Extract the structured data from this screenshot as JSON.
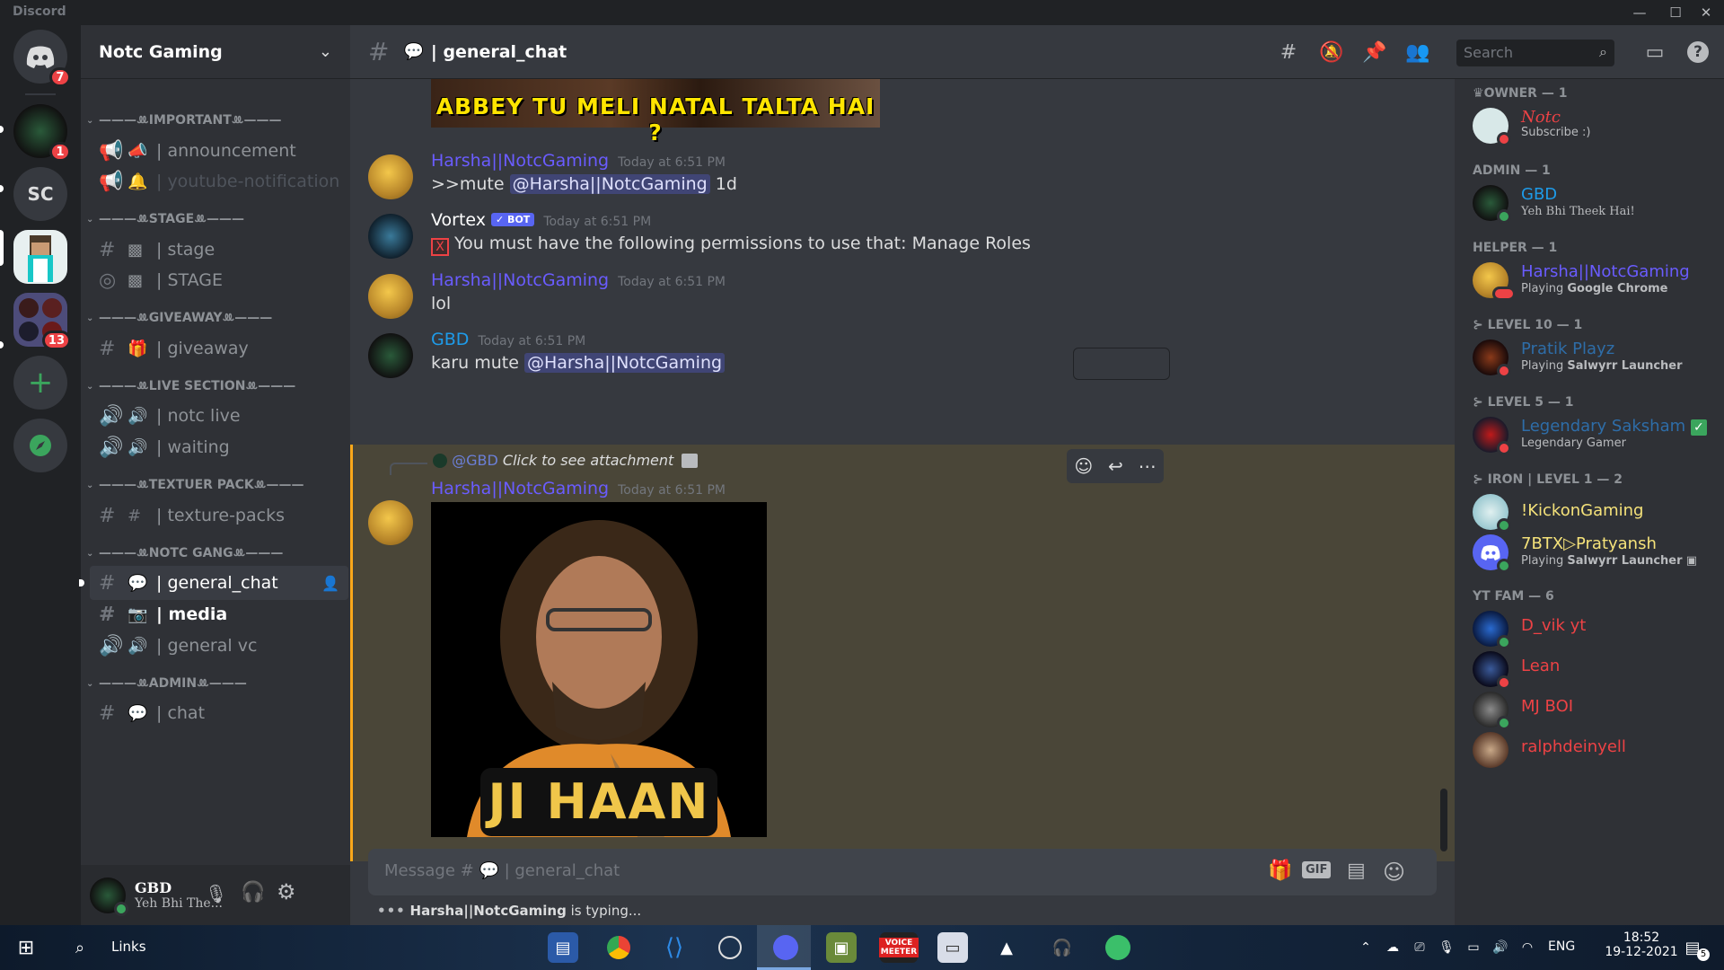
{
  "window": {
    "brand": "Discord"
  },
  "servers": [
    {
      "label": "",
      "badge": "7"
    },
    {
      "label": "",
      "badge": "1"
    },
    {
      "label": "SC",
      "badge": ""
    },
    {
      "label": "",
      "badge": ""
    },
    {
      "label": "",
      "badge": "13"
    }
  ],
  "guild": {
    "name": "Notc Gaming"
  },
  "categories": [
    "IMPORTANT",
    "STAGE",
    "GIVEAWAY",
    "LIVE SECTION",
    "TEXTUER PACK",
    "NOTC GANG",
    "ADMIN"
  ],
  "channels": {
    "announcement": "| announcement",
    "youtube": "| youtube-notification",
    "stage": "| stage",
    "stage2": "| STAGE",
    "giveaway": "| giveaway",
    "notc_live": "| notc live",
    "waiting": "| waiting",
    "texture": "| texture-packs",
    "general_chat": "| general_chat",
    "media": "| media",
    "general_vc": "| general vc",
    "chat": "| chat"
  },
  "user": {
    "name": "GBD",
    "status": "Yeh Bhi The..."
  },
  "header": {
    "channel": "| general_chat",
    "search_placeholder": "Search"
  },
  "messages": {
    "meme_top_caption": "ABBEY TU MELI NATAL TALTA HAI ?",
    "m1": {
      "author": "Harsha||NotcGaming",
      "time": "Today at 6:51 PM",
      "prefix": ">>mute ",
      "mention": "@Harsha||NotcGaming",
      "suffix": " 1d"
    },
    "m2": {
      "author": "Vortex",
      "bot_tag": "✓ BOT",
      "time": "Today at 6:51 PM",
      "text": "You must have the following permissions to use that: Manage Roles"
    },
    "m3": {
      "author": "Harsha||NotcGaming",
      "time": "Today at 6:51 PM",
      "text": "lol"
    },
    "m4": {
      "author": "GBD",
      "time": "Today at 6:51 PM",
      "prefix": "karu mute ",
      "mention": "@Harsha||NotcGaming"
    },
    "m5": {
      "reply_user": "@GBD",
      "reply_text": "Click to see attachment",
      "author": "Harsha||NotcGaming",
      "time": "Today at 6:51 PM",
      "image_caption": "JI HAAN"
    }
  },
  "composer": {
    "placeholder_prefix": "Message #",
    "placeholder_channel": "| general_chat",
    "gif": "GIF"
  },
  "typing": {
    "user": "Harsha||NotcGaming",
    "text": " is typing..."
  },
  "members": {
    "owner_cat": "OWNER — 1",
    "owner": {
      "name": "Notc",
      "sub": "Subscribe :)"
    },
    "admin_cat": "ADMIN — 1",
    "admin": {
      "name": "GBD",
      "sub": "Yeh Bhi Theek Hai!"
    },
    "helper_cat": "HELPER — 1",
    "helper": {
      "name": "Harsha||NotcGaming",
      "sub_prefix": "Playing ",
      "sub_bold": "Google Chrome"
    },
    "lvl10_cat": "LEVEL 10 — 1",
    "lvl10": {
      "name": "Pratik Playz",
      "sub_prefix": "Playing ",
      "sub_bold": "Salwyrr Launcher"
    },
    "lvl5_cat": "LEVEL 5 — 1",
    "lvl5": {
      "name": "Legendary Saksham",
      "sub": "Legendary Gamer"
    },
    "iron_cat": "IRON | LEVEL 1 — 2",
    "iron1": {
      "name": "!KickonGaming"
    },
    "iron2": {
      "name": "7BTX▷Pratyansh",
      "sub_prefix": "Playing ",
      "sub_bold": "Salwyrr Launcher"
    },
    "ytfam_cat": "YT FAM — 6",
    "yt1": {
      "name": "D_vik yt"
    },
    "yt2": {
      "name": "Lean"
    },
    "yt3": {
      "name": "MJ BOI"
    },
    "yt4": {
      "name": "ralphdeinyell"
    }
  },
  "taskbar": {
    "search_label": "Links",
    "lang": "ENG",
    "time": "18:52",
    "date": "19-12-2021",
    "notif_count": "5",
    "voicemeeter": "VOICE MEETER"
  },
  "colors": {
    "blurple": "#5865f2",
    "green": "#3ba55d",
    "red": "#ed4245",
    "highlight_bg": "#4a4638",
    "highlight_bar": "#faa81a"
  }
}
